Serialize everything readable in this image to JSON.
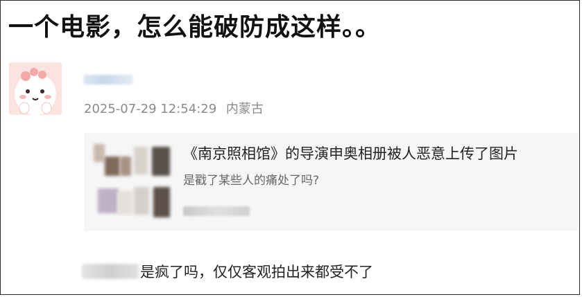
{
  "post": {
    "title": "一个电影，怎么能破防成这样。。",
    "timestamp": "2025-07-29 12:54:29",
    "location": "内蒙古"
  },
  "shared_card": {
    "title": "《南京照相馆》的导演申奥相册被人恶意上传了图片",
    "subtitle": "是戳了某些人的痛处了吗?"
  },
  "reply": {
    "text": "是疯了吗，仅仅客观拍出来都受不了"
  },
  "colors": {
    "border": "#2a2a2a",
    "meta_text": "#8a8a8a",
    "card_bg": "#f6f6f6",
    "avatar_bg": "#fbe3e0"
  }
}
